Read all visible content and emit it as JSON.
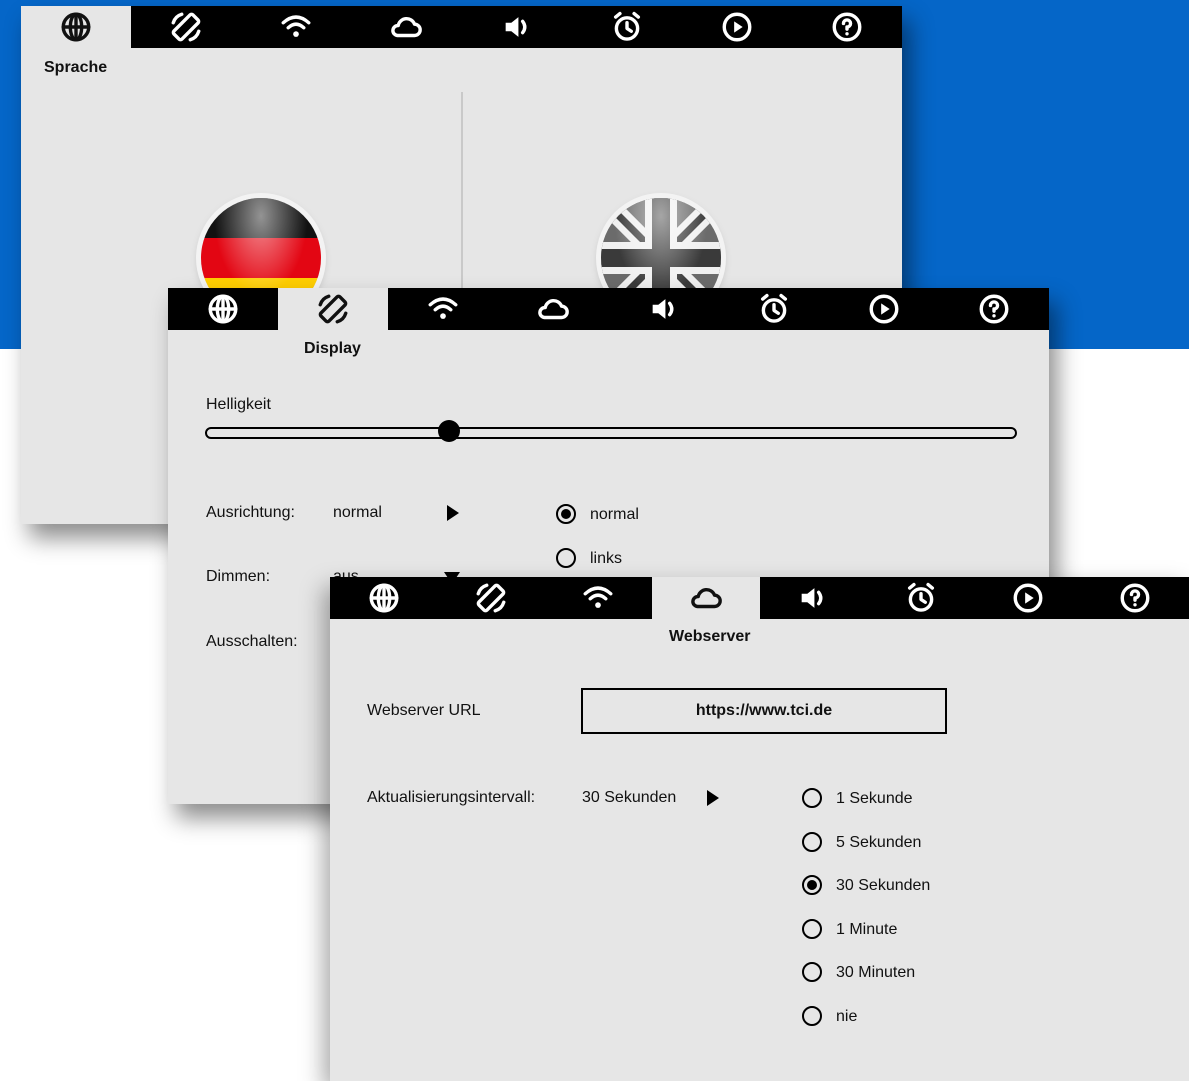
{
  "tabs": [
    {
      "icon": "globe-icon"
    },
    {
      "icon": "screen-rotation-icon"
    },
    {
      "icon": "wifi-icon"
    },
    {
      "icon": "cloud-icon"
    },
    {
      "icon": "speaker-icon"
    },
    {
      "icon": "alarm-clock-icon"
    },
    {
      "icon": "play-icon"
    },
    {
      "icon": "help-icon"
    }
  ],
  "sprache": {
    "caption": "Sprache",
    "flags": [
      "german-flag",
      "uk-flag"
    ]
  },
  "display": {
    "caption": "Display",
    "brightness_label": "Helligkeit",
    "brightness_level": 0.3,
    "orientation_label": "Ausrichtung:",
    "orientation_value": "normal",
    "orientation_options": [
      "normal",
      "links"
    ],
    "orientation_selected": "normal",
    "dim_label": "Dimmen:",
    "dim_value": "aus",
    "off_label": "Ausschalten:"
  },
  "webserver": {
    "caption": "Webserver",
    "url_label": "Webserver URL",
    "url_value": "https://www.tci.de",
    "interval_label": "Aktualisierungsintervall:",
    "interval_value": "30 Sekunden",
    "interval_options": [
      "1 Sekunde",
      "5 Sekunden",
      "30 Sekunden",
      "1 Minute",
      "30 Minuten",
      "nie"
    ],
    "interval_selected": "30 Sekunden"
  },
  "colors": {
    "background_accent": "#0566c8",
    "panel": "#e6e6e6",
    "tabbar": "#000000"
  }
}
